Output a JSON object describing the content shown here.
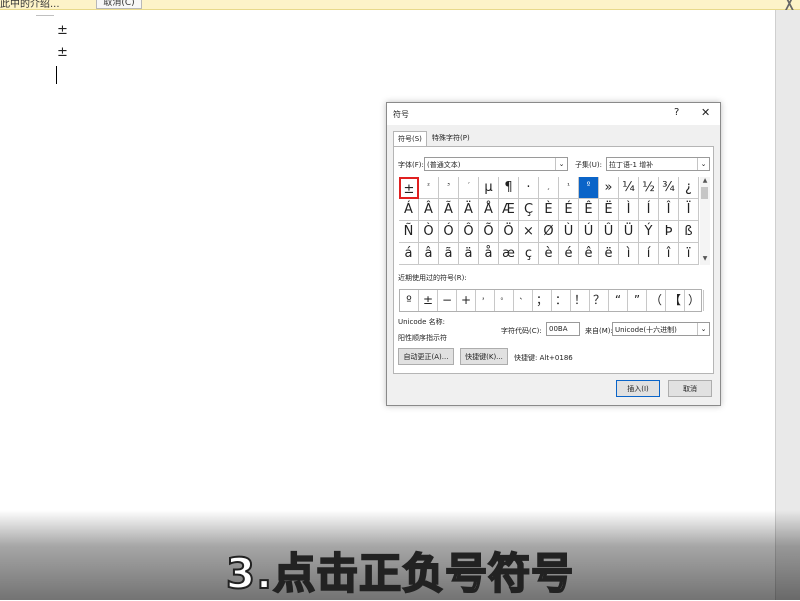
{
  "notification": {
    "text": "此中的介绍...",
    "button_label": "取消(C)"
  },
  "document": {
    "lines": [
      "±",
      "±"
    ]
  },
  "dialog": {
    "title": "符号",
    "help": "?",
    "close": "✕",
    "tabs": [
      {
        "label": "符号(S)",
        "active": true
      },
      {
        "label": "特殊字符(P)",
        "active": false
      }
    ],
    "font_label": "字体(F):",
    "font_value": "(普通文本)",
    "subset_label": "子集(U):",
    "subset_value": "拉丁语-1 增补",
    "symbols": [
      [
        "±",
        "²",
        "³",
        "´",
        "µ",
        "¶",
        "·",
        "¸",
        "¹",
        "º",
        "»",
        "¼",
        "½",
        "¾",
        "¿",
        "À"
      ],
      [
        "Á",
        "Â",
        "Ã",
        "Ä",
        "Å",
        "Æ",
        "Ç",
        "È",
        "É",
        "Ê",
        "Ë",
        "Ì",
        "Í",
        "Î",
        "Ï",
        "Ð"
      ],
      [
        "Ñ",
        "Ò",
        "Ó",
        "Ô",
        "Õ",
        "Ö",
        "×",
        "Ø",
        "Ù",
        "Ú",
        "Û",
        "Ü",
        "Ý",
        "Þ",
        "ß",
        "à"
      ],
      [
        "á",
        "â",
        "ã",
        "ä",
        "å",
        "æ",
        "ç",
        "è",
        "é",
        "ê",
        "ë",
        "ì",
        "í",
        "î",
        "ï",
        "ð"
      ]
    ],
    "recent_label": "近期使用过的符号(R):",
    "recent_symbols": [
      "º",
      "±",
      "−",
      "+",
      "，",
      "。",
      "、",
      "；",
      "：",
      "！",
      "？",
      "“",
      "”",
      "（",
      "【",
      "）"
    ],
    "unicode_name_label": "Unicode 名称:",
    "unicode_name_value": "阳性顺序指示符",
    "char_code_label": "字符代码(C):",
    "char_code_value": "00BA",
    "from_label": "来自(M):",
    "from_value": "Unicode(十六进制)",
    "autocorrect_button": "自动更正(A)...",
    "shortcut_button": "快捷键(K)...",
    "shortcut_text": "快捷键: Alt+0186",
    "insert_button": "插入(I)",
    "cancel_button": "取消"
  },
  "caption": "3.点击正负号符号",
  "colors": {
    "highlight": "#e02020",
    "selection": "#0a64c8"
  }
}
